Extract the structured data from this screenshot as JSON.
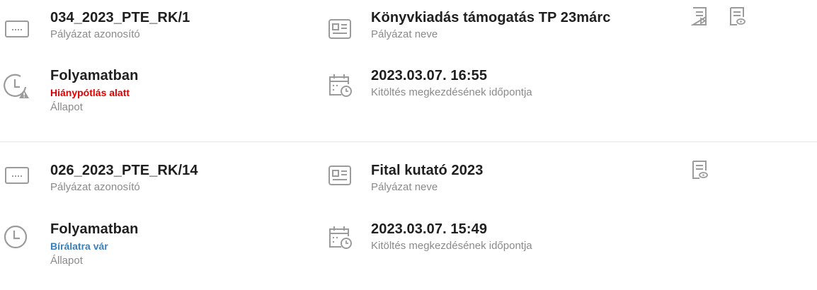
{
  "applications": [
    {
      "id_value": "034_2023_PTE_RK/1",
      "id_label": "Pályázat azonosító",
      "name_value": "Könyvkiadás támogatás TP 23márc",
      "name_label": "Pályázat neve",
      "state_value": "Folyamatban",
      "state_sub": "Hiánypótlás alatt",
      "state_label": "Állapot",
      "date_value": "2023.03.07. 16:55",
      "date_label": "Kitöltés megkezdésének időpontja",
      "actions": [
        "document-play-icon",
        "document-view-icon"
      ]
    },
    {
      "id_value": "026_2023_PTE_RK/14",
      "id_label": "Pályázat azonosító",
      "name_value": "Fital kutató 2023",
      "name_label": "Pályázat neve",
      "state_value": "Folyamatban",
      "state_sub": "Bírálatra vár",
      "state_label": "Állapot",
      "date_value": "2023.03.07. 15:49",
      "date_label": "Kitöltés megkezdésének időpontja",
      "actions": [
        "document-view-icon"
      ]
    }
  ],
  "colors": {
    "status_red": "#e00000",
    "status_blue": "#3a7fb8",
    "icon_gray": "#9b9b9b"
  }
}
